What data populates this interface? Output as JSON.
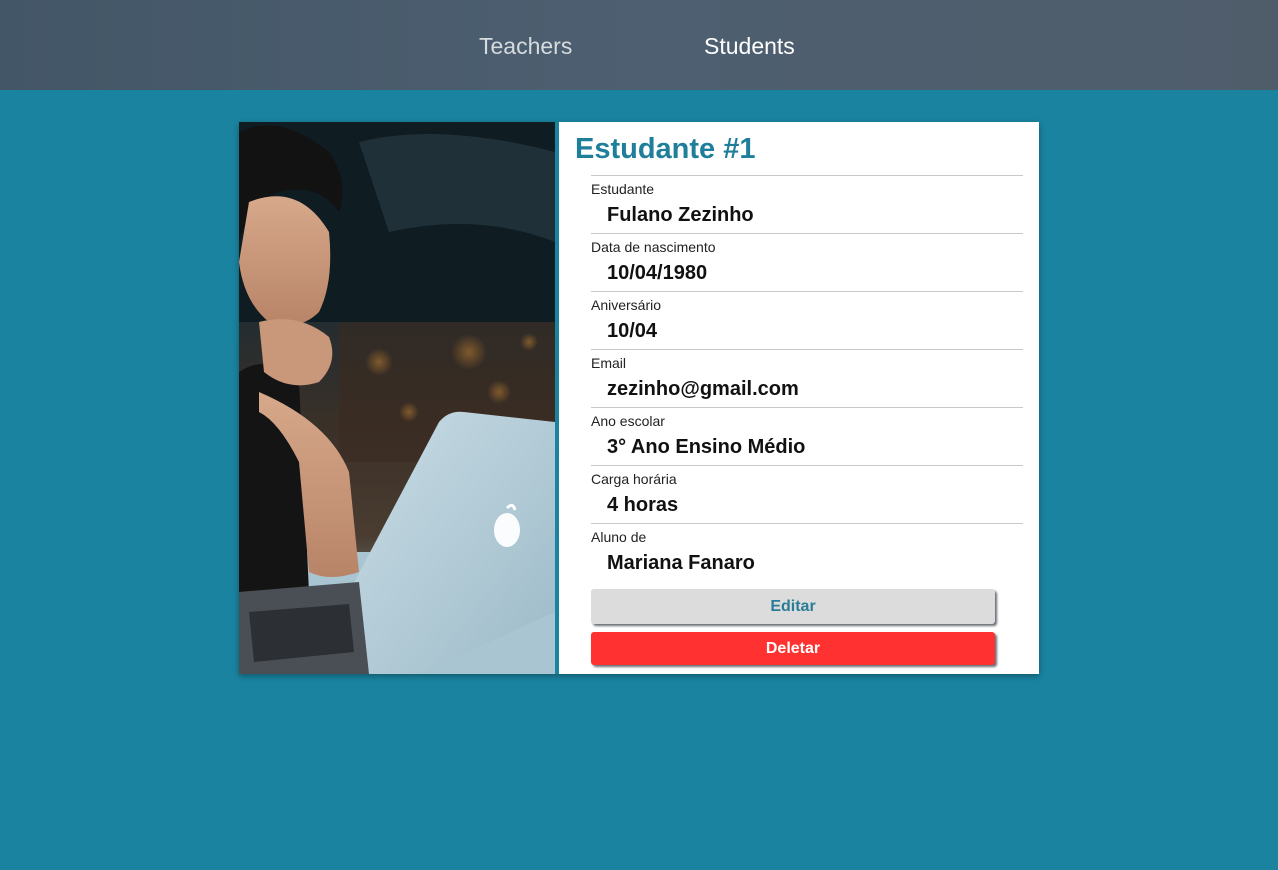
{
  "nav": {
    "teachers_label": "Teachers",
    "students_label": "Students"
  },
  "card": {
    "title": "Estudante #1",
    "photo_alt": "",
    "fields": [
      {
        "label": "Estudante",
        "value": "Fulano Zezinho"
      },
      {
        "label": "Data de nascimento",
        "value": "10/04/1980"
      },
      {
        "label": "Aniversário",
        "value": "10/04"
      },
      {
        "label": "Email",
        "value": "zezinho@gmail.com"
      },
      {
        "label": "Ano escolar",
        "value": "3° Ano Ensino Médio"
      },
      {
        "label": "Carga horária",
        "value": "4 horas"
      },
      {
        "label": "Aluno de",
        "value": "Mariana Fanaro"
      }
    ],
    "edit_label": "Editar",
    "delete_label": "Deletar"
  },
  "colors": {
    "background": "#1a84a0",
    "topbar": "#4d5f70",
    "accent": "#1f7f9a",
    "delete": "#ff3131",
    "edit_bg": "#dcdcdc"
  }
}
